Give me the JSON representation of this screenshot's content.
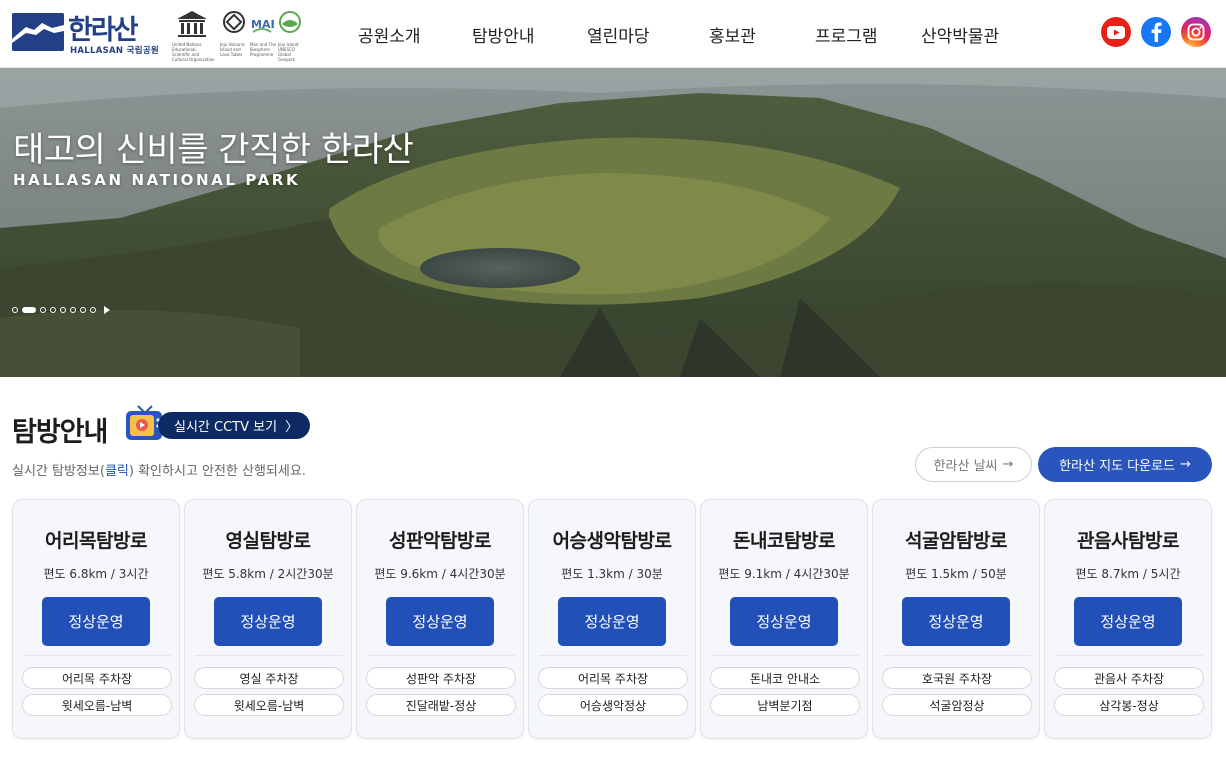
{
  "header": {
    "logo_text": "한라산",
    "logo_sub": "HALLASAN 국립공원",
    "unesco_captions": [
      "United Nations Educational, Scientific and Cultural Organization",
      "Jeju Volcanic Island and Lava Tubes",
      "Man and The Biosphere Programme",
      "Jeju Island UNESCO Global Geopark"
    ],
    "nav": [
      "공원소개",
      "탐방안내",
      "열린마당",
      "홍보관",
      "프로그램",
      "산악박물관"
    ],
    "social": [
      {
        "name": "youtube",
        "icon": "youtube-icon",
        "color": "#e62117"
      },
      {
        "name": "facebook",
        "icon": "facebook-icon",
        "color": "#1877f2"
      },
      {
        "name": "instagram",
        "icon": "instagram-icon",
        "color": "#e0285a"
      }
    ]
  },
  "hero": {
    "title": "태고의 신비를 간직한 한라산",
    "subtitle": "HALLASAN NATIONAL PARK",
    "slide_count": 8,
    "active_slide": 2
  },
  "section": {
    "title": "탐방안내",
    "cctv_label": "실시간 CCTV 보기",
    "desc_before": "실시간 탐방정보(",
    "desc_link": "클릭",
    "desc_after": ") 확인하시고 안전한 산행되세요.",
    "weather_label": "한라산 날씨",
    "map_label": "한라산 지도 다운로드",
    "arrow": "→",
    "cctv_arrow": "〉"
  },
  "colors": {
    "primary": "#2150b9",
    "navy": "#0e2a63",
    "brand": "#233f86"
  },
  "trails": [
    {
      "name": "어리목탐방로",
      "info": "편도 6.8km / 3시간",
      "status": "정상운영",
      "tags": [
        "어리목 주차장",
        "윗세오름-남벽"
      ]
    },
    {
      "name": "영실탐방로",
      "info": "편도 5.8km / 2시간30분",
      "status": "정상운영",
      "tags": [
        "영실 주차장",
        "윗세오름-남벽"
      ]
    },
    {
      "name": "성판악탐방로",
      "info": "편도 9.6km / 4시간30분",
      "status": "정상운영",
      "tags": [
        "성판악 주차장",
        "진달래밭-정상"
      ]
    },
    {
      "name": "어승생악탐방로",
      "info": "편도 1.3km / 30분",
      "status": "정상운영",
      "tags": [
        "어리목 주차장",
        "어승생악정상"
      ]
    },
    {
      "name": "돈내코탐방로",
      "info": "편도 9.1km / 4시간30분",
      "status": "정상운영",
      "tags": [
        "돈내코 안내소",
        "남벽분기점"
      ]
    },
    {
      "name": "석굴암탐방로",
      "info": "편도 1.5km / 50분",
      "status": "정상운영",
      "tags": [
        "호국원 주차장",
        "석굴암정상"
      ]
    },
    {
      "name": "관음사탐방로",
      "info": "편도 8.7km / 5시간",
      "status": "정상운영",
      "tags": [
        "관음사 주차장",
        "삼각봉-정상"
      ]
    }
  ]
}
